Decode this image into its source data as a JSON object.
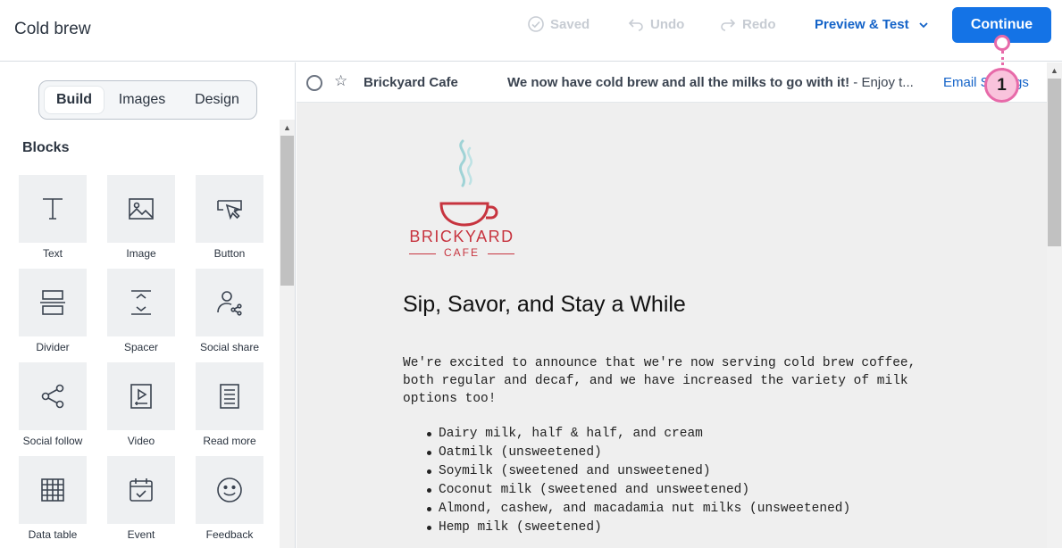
{
  "header": {
    "title": "Cold brew",
    "saved_label": "Saved",
    "undo_label": "Undo",
    "redo_label": "Redo",
    "preview_label": "Preview & Test",
    "continue_label": "Continue"
  },
  "callout": {
    "number": "1"
  },
  "left_panel": {
    "tabs": [
      {
        "label": "Build",
        "active": true
      },
      {
        "label": "Images",
        "active": false
      },
      {
        "label": "Design",
        "active": false
      }
    ],
    "blocks_title": "Blocks",
    "blocks": [
      {
        "label": "Text",
        "icon": "text-icon"
      },
      {
        "label": "Image",
        "icon": "image-icon"
      },
      {
        "label": "Button",
        "icon": "cursor-click-icon"
      },
      {
        "label": "Divider",
        "icon": "divider-icon"
      },
      {
        "label": "Spacer",
        "icon": "spacer-icon"
      },
      {
        "label": "Social share",
        "icon": "social-share-icon"
      },
      {
        "label": "Social follow",
        "icon": "share-nodes-icon"
      },
      {
        "label": "Video",
        "icon": "video-icon"
      },
      {
        "label": "Read more",
        "icon": "document-icon"
      },
      {
        "label": "Data table",
        "icon": "table-icon"
      },
      {
        "label": "Event",
        "icon": "calendar-icon"
      },
      {
        "label": "Feedback",
        "icon": "smiley-icon"
      }
    ]
  },
  "email_row": {
    "left_link_fragment": "gs",
    "sender": "Brickyard Cafe",
    "subject": "We now have cold brew and all the milks to go with it!",
    "preview": " - Enjoy t...",
    "link": "Email Settings"
  },
  "email": {
    "logo_name": "BRICKYARD",
    "logo_sub": "CAFE",
    "headline": "Sip, Savor, and Stay a While",
    "paragraph": "We're excited to announce that we're now serving cold brew coffee, both regular and decaf, and we have increased the variety of milk options too!",
    "bullets": [
      "Dairy milk, half & half, and cream",
      "Oatmilk (unsweetened)",
      "Soymilk (sweetened and unsweetened)",
      "Coconut milk (sweetened and unsweetened)",
      "Almond, cashew, and macadamia nut milks (unsweetened)",
      "Hemp milk (sweetened)"
    ]
  },
  "colors": {
    "accent": "#1473e6",
    "link": "#1463c8",
    "callout": "#e76aa9",
    "brand_red": "#c7343f",
    "brand_teal": "#9fd3d6"
  }
}
